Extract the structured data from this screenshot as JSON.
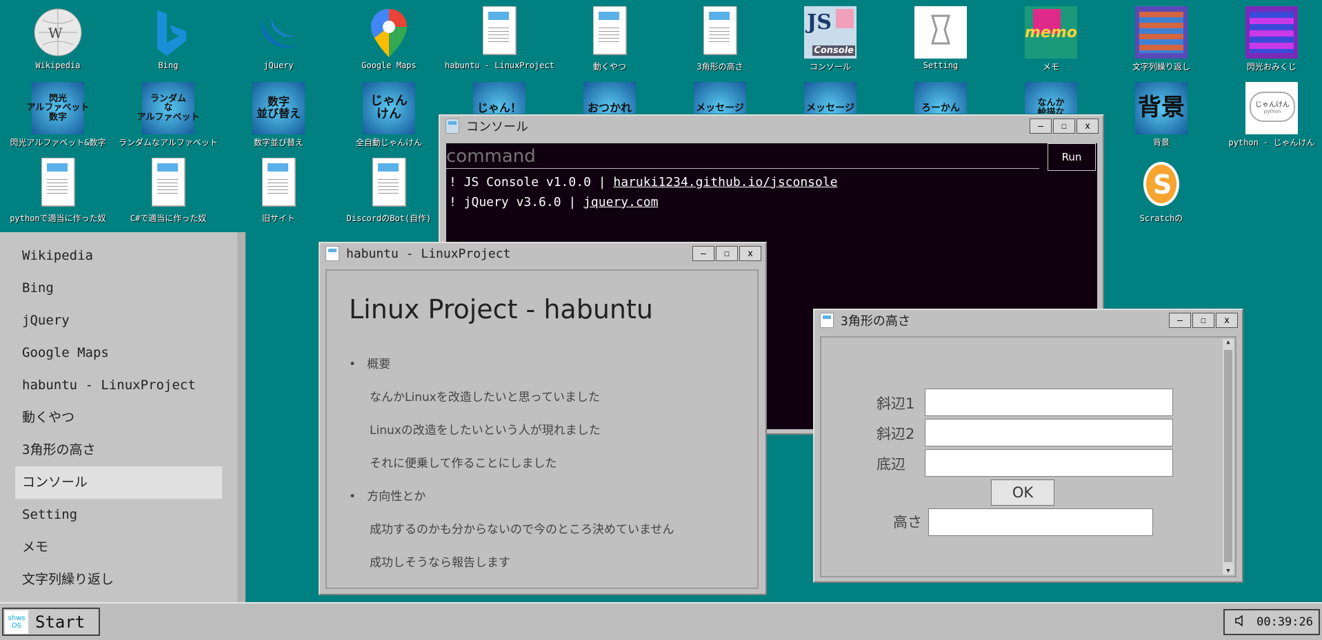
{
  "desktop": {
    "icons": [
      {
        "label": "Wikipedia",
        "icon": "wikipedia-globe-icon"
      },
      {
        "label": "Bing",
        "icon": "bing-logo-icon"
      },
      {
        "label": "jQuery",
        "icon": "jquery-logo-icon"
      },
      {
        "label": "Google Maps",
        "icon": "map-pin-icon"
      },
      {
        "label": "habuntu - LinuxProject",
        "icon": "document-icon"
      },
      {
        "label": "動くやつ",
        "icon": "document-icon"
      },
      {
        "label": "3角形の高さ",
        "icon": "document-icon"
      },
      {
        "label": "コンソール",
        "icon": "js-console-icon"
      },
      {
        "label": "Setting",
        "icon": "settings-icon"
      },
      {
        "label": "メモ",
        "icon": "memo-icon"
      },
      {
        "label": "文字列繰り返し",
        "icon": "string-repeat-icon"
      },
      {
        "label": "閃光おみくじ",
        "icon": "omikuji-icon"
      },
      {
        "label": "閃光アルファベット&数字",
        "icon": "alphabet-number-icon"
      },
      {
        "label": "ランダムなアルファベット",
        "icon": "random-alphabet-icon"
      },
      {
        "label": "数字並び替え",
        "icon": "number-sort-icon"
      },
      {
        "label": "全自動じゃんけん",
        "icon": "janken-icon"
      },
      {
        "label": "背景",
        "icon": "background-icon"
      },
      {
        "label": "python - じゃんけん",
        "icon": "python-janken-icon"
      },
      {
        "label": "pythonで適当に作った奴",
        "icon": "document-icon"
      },
      {
        "label": "C#で適当に作った奴",
        "icon": "document-icon"
      },
      {
        "label": "旧サイト",
        "icon": "document-icon"
      },
      {
        "label": "DiscordのBot(自作)",
        "icon": "document-icon"
      },
      {
        "label": "Scratchの",
        "icon": "scratch-icon"
      }
    ],
    "tile_text": {
      "js_label": "JS",
      "console_label": "Console",
      "memo": "memo",
      "bg": "背景",
      "janken_badge": "じゃんけん",
      "janken_sub": "python",
      "alpha1": "閃光\nアルファベット\n数字",
      "alpha2": "ランダム\nな\nアルファベット",
      "alpha3": "数字\n並び替え",
      "alpha4": "じゃん\nけん",
      "r1": "じゃん！",
      "r2": "おつかれ",
      "r3": "メッセージ",
      "r4": "メッセージ",
      "r5": "ろーかん",
      "r6": "なんか\n絵描な"
    }
  },
  "console_window": {
    "title": "コンソール",
    "command_placeholder": "command",
    "run_label": "Run",
    "lines": [
      {
        "prefix": "! JS Console v1.0.0 | ",
        "link": "haruki1234.github.io/jsconsole"
      },
      {
        "prefix": "! jQuery v3.6.0 | ",
        "link": "jquery.com"
      }
    ]
  },
  "habuntu_window": {
    "title": "habuntu - LinuxProject",
    "heading": "Linux Project - habuntu",
    "sections": [
      {
        "bullet": "概要",
        "lines": [
          "なんかLinuxを改造したいと思っていました",
          "Linuxの改造をしたいという人が現れました",
          "それに便乗して作ることにしました"
        ]
      },
      {
        "bullet": "方向性とか",
        "lines": [
          "成功するのかも分からないので今のところ決めていません",
          "成功しそうなら報告します"
        ]
      }
    ]
  },
  "triangle_window": {
    "title": "3角形の高さ",
    "side1_label": "斜辺1",
    "side2_label": "斜辺2",
    "base_label": "底辺",
    "ok_label": "OK",
    "height_label": "高さ",
    "side1_value": "",
    "side2_value": "",
    "base_value": "",
    "height_value": ""
  },
  "window_buttons": {
    "minimize": "—",
    "maximize": "☐",
    "close": "x"
  },
  "sidebar": {
    "items": [
      "Wikipedia",
      "Bing",
      "jQuery",
      "Google Maps",
      "habuntu - LinuxProject",
      "動くやつ",
      "3角形の高さ",
      "コンソール",
      "Setting",
      "メモ",
      "文字列繰り返し"
    ],
    "active_index": 7
  },
  "taskbar": {
    "start_label": "Start",
    "logo_text": "shws\nOS",
    "clock": "00:39:26",
    "volume_icon": "speaker-icon"
  },
  "colors": {
    "desktop": "#008080",
    "console_bg": "#10000f",
    "link": "#ffffff"
  }
}
